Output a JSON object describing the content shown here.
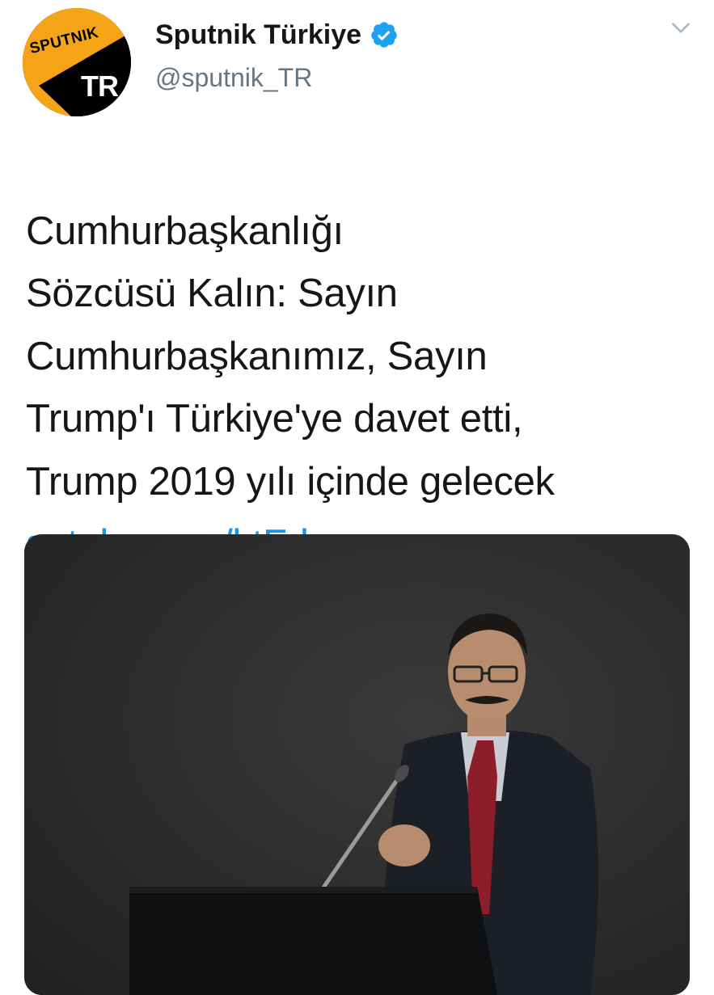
{
  "account": {
    "display_name": "Sputnik Türkiye",
    "handle": "@sputnik_TR",
    "verified": true,
    "avatar": {
      "top_label": "SPUTNIK",
      "bottom_label": "TR",
      "brand_color": "#f5a418"
    }
  },
  "tweet": {
    "text": "Cumhurbaşkanlığı\nSözcüsü Kalın: Sayın\nCumhurbaşkanımız, Sayın\nTrump'ı Türkiye'ye davet etti,\nTrump 2019 yılı içinde gelecek",
    "link_text": "sptnkne.ws/ktFd",
    "link_color": "#1b95e0"
  },
  "media": {
    "type": "photo"
  },
  "icons": {
    "verified": "verified-badge-icon",
    "menu": "chevron-down-icon"
  }
}
